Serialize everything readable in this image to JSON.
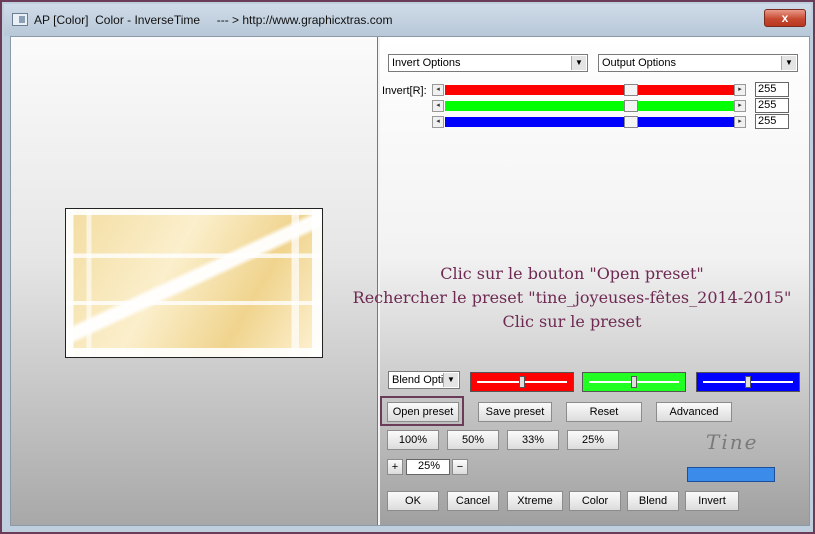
{
  "window": {
    "title": "AP [Color]  Color - InverseTime     --- > http://www.graphicxtras.com",
    "close_glyph": "x"
  },
  "dropdowns": {
    "invert_options": "Invert Options",
    "output_options": "Output Options",
    "blend_options": "Blend Optic"
  },
  "sliders": {
    "label": "Invert[R]:",
    "rows": [
      {
        "channel": "red",
        "color": "#ff0000",
        "value": "255",
        "level": 1.0
      },
      {
        "channel": "green",
        "color": "#00ff00",
        "value": "255",
        "level": 1.0
      },
      {
        "channel": "blue",
        "color": "#0000ff",
        "value": "255",
        "level": 1.0
      }
    ]
  },
  "annotation": {
    "line1": "Clic sur le bouton \"Open preset\"",
    "line2": "Rechercher le preset \"tine_joyeuses-fêtes_2014-2015\"",
    "line3": "Clic sur le preset"
  },
  "swatches": [
    {
      "color": "#ff0000",
      "level": 0.5
    },
    {
      "color": "#00ff00",
      "level": 0.5
    },
    {
      "color": "#0000ff",
      "level": 0.5
    }
  ],
  "buttons": {
    "open_preset": "Open preset",
    "save_preset": "Save preset",
    "reset": "Reset",
    "advanced": "Advanced",
    "zoom_100": "100%",
    "zoom_50": "50%",
    "zoom_33": "33%",
    "zoom_25": "25%",
    "zoom_plus": "+",
    "zoom_minus": "−",
    "zoom_value": "25%",
    "ok": "OK",
    "cancel": "Cancel",
    "xtreme": "Xtreme",
    "color": "Color",
    "blend": "Blend",
    "invert": "Invert"
  },
  "signature": "Tine",
  "colors": {
    "highlight": "#6b3c57",
    "annotation_text": "#6e2a52",
    "accent_blue": "#3a8bea"
  },
  "icons": {
    "title": "app-window-icon",
    "dropdown": "chevron-down-icon",
    "slider_left": "arrow-left-icon",
    "slider_right": "arrow-right-icon"
  }
}
